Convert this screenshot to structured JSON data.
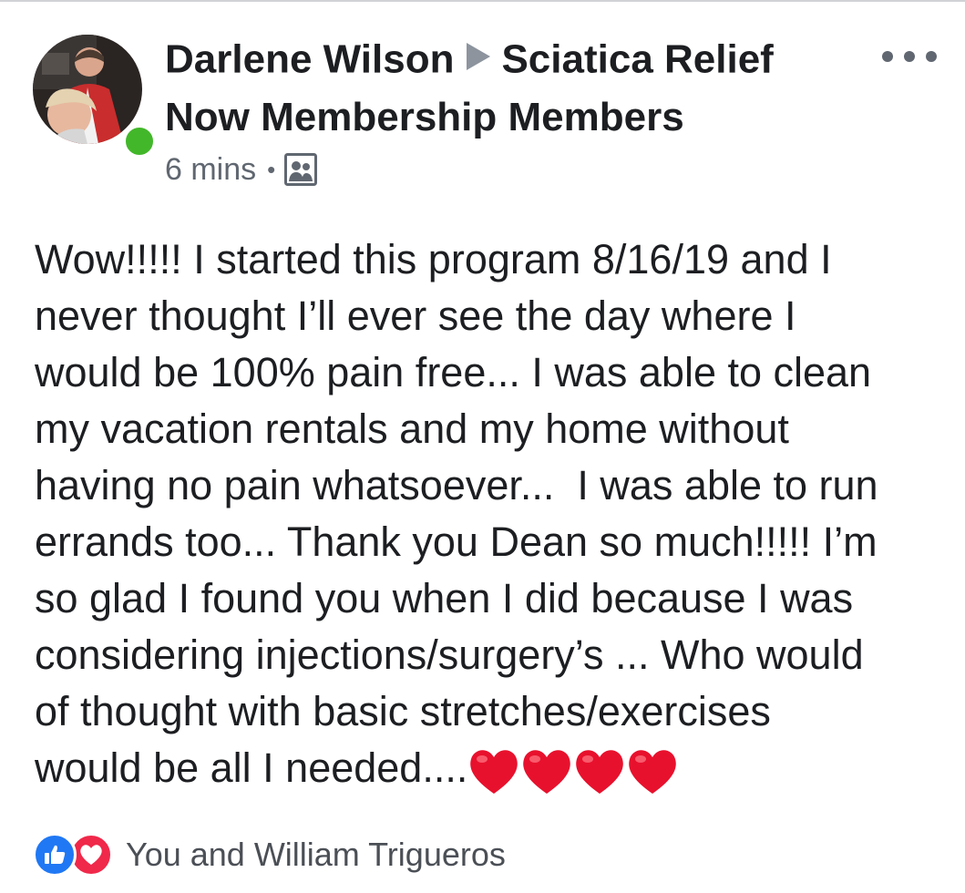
{
  "post": {
    "author": "Darlene Wilson",
    "group": "Sciatica Relief Now Membership Members",
    "time": "6 mins",
    "separator": "•",
    "audience_icon": "group-audience-icon",
    "body": "Wow!!!!! I started this program 8/16/19 and I\nnever thought I’ll ever see the day where I\nwould be 100% pain free... I was able to clean\nmy vacation rentals and my home without\nhaving no pain whatsoever...  I was able to run\nerrands too... Thank you Dean so much!!!!! I’m\nso glad I found you when I did because I was\nconsidering injections/surgery’s ... Who would\nof thought with basic stretches/exercises\nwould be all I needed....",
    "emoji_count": 4
  },
  "reactions": {
    "types": [
      "like",
      "love"
    ],
    "names": "You and William Trigueros"
  },
  "colors": {
    "online": "#42b72a",
    "like": "#2078f4",
    "love": "#f0284a",
    "heart_emoji": "#e8112d"
  }
}
